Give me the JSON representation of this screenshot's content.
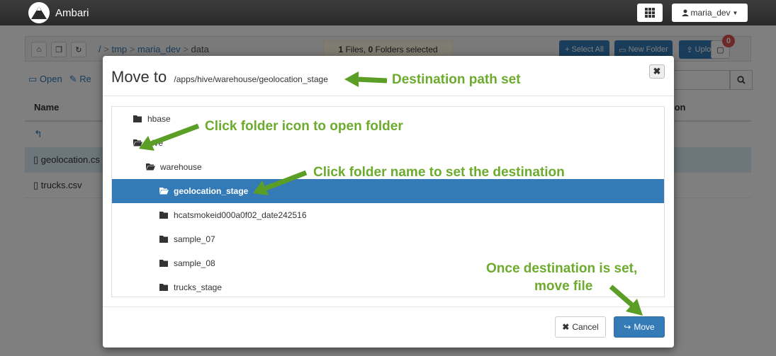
{
  "navbar": {
    "brand": "Ambari",
    "user": "maria_dev"
  },
  "toolbar": {
    "breadcrumb_root": "/",
    "breadcrumb_sep": ">",
    "breadcrumb_1": "tmp",
    "breadcrumb_2": "maria_dev",
    "breadcrumb_3": "data",
    "selection_count_files": "1",
    "selection_files_word": "Files,",
    "selection_count_folders": "0",
    "selection_folders_word": "Folders selected",
    "select_all": "Select All",
    "new_folder": "New Folder",
    "upload": "Upload",
    "notifications": "0"
  },
  "actions": {
    "open": "Open",
    "rename_partial": "Re"
  },
  "table": {
    "col_name": "Name",
    "col_permission_partial": "ion",
    "rows": [
      {
        "name": "geolocation.cs"
      },
      {
        "name": "trucks.csv"
      }
    ]
  },
  "modal": {
    "title": "Move to",
    "path": "/apps/hive/warehouse/geolocation_stage",
    "tree": [
      {
        "label": "hbase",
        "open": false
      },
      {
        "label": "hive",
        "open": true
      },
      {
        "label": "warehouse",
        "open": true
      },
      {
        "label": "geolocation_stage",
        "open": true,
        "selected": true
      },
      {
        "label": "hcatsmokeid000a0f02_date242516",
        "open": false
      },
      {
        "label": "sample_07",
        "open": false
      },
      {
        "label": "sample_08",
        "open": false
      },
      {
        "label": "trucks_stage",
        "open": false
      }
    ],
    "cancel": "Cancel",
    "move": "Move"
  },
  "annotations": {
    "destination_path": "Destination path set",
    "folder_icon": "Click folder icon to open folder",
    "folder_name": "Click folder name to set the destination",
    "move_line1": "Once destination is set,",
    "move_line2": "move file",
    "color": "#6cab2e"
  },
  "colors": {
    "primary": "#337ab7",
    "selection_highlight": "#fcf8e3",
    "badge": "#d9534f"
  }
}
